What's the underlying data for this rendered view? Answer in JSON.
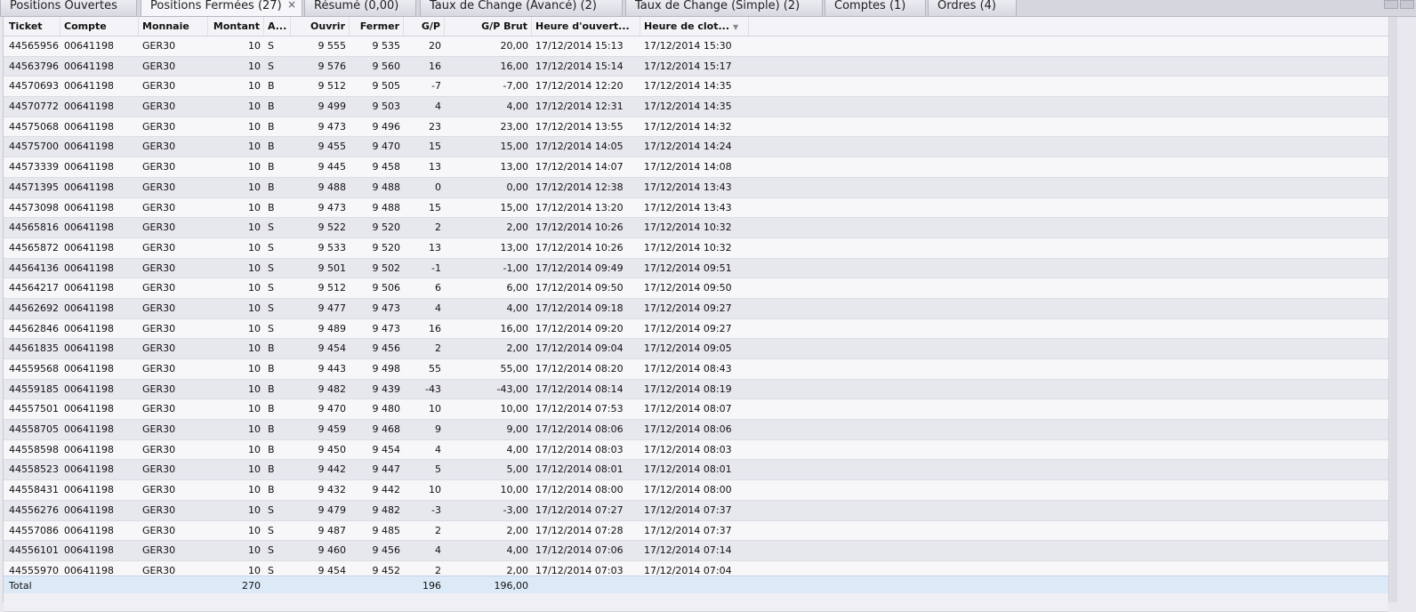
{
  "tabs": [
    {
      "label": "Positions Ouvertes",
      "active": false
    },
    {
      "label": "Positions Fermées (27)",
      "active": true,
      "closable": true
    },
    {
      "label": "Résumé (0,00)",
      "active": false
    },
    {
      "label": "Taux de Change (Avancé) (2)",
      "active": false
    },
    {
      "label": "Taux de Change (Simple) (2)",
      "active": false
    },
    {
      "label": "Comptes (1)",
      "active": false
    },
    {
      "label": "Ordres (4)",
      "active": false
    }
  ],
  "close_glyph": "×",
  "columns": [
    "Ticket",
    "Compte",
    "Monnaie",
    "Montant",
    "A...",
    "Ouvrir",
    "Fermer",
    "G/P",
    "G/P Brut",
    "Heure d'ouvert...",
    "Heure de clot..."
  ],
  "sorted_column_icon": "sort-descending-icon",
  "rows": [
    [
      "44565956",
      "00641198",
      "GER30",
      "10",
      "S",
      "9 555",
      "9 535",
      "20",
      "20,00",
      "17/12/2014 15:13",
      "17/12/2014 15:30"
    ],
    [
      "44563796",
      "00641198",
      "GER30",
      "10",
      "S",
      "9 576",
      "9 560",
      "16",
      "16,00",
      "17/12/2014 15:14",
      "17/12/2014 15:17"
    ],
    [
      "44570693",
      "00641198",
      "GER30",
      "10",
      "B",
      "9 512",
      "9 505",
      "-7",
      "-7,00",
      "17/12/2014 12:20",
      "17/12/2014 14:35"
    ],
    [
      "44570772",
      "00641198",
      "GER30",
      "10",
      "B",
      "9 499",
      "9 503",
      "4",
      "4,00",
      "17/12/2014 12:31",
      "17/12/2014 14:35"
    ],
    [
      "44575068",
      "00641198",
      "GER30",
      "10",
      "B",
      "9 473",
      "9 496",
      "23",
      "23,00",
      "17/12/2014 13:55",
      "17/12/2014 14:32"
    ],
    [
      "44575700",
      "00641198",
      "GER30",
      "10",
      "B",
      "9 455",
      "9 470",
      "15",
      "15,00",
      "17/12/2014 14:05",
      "17/12/2014 14:24"
    ],
    [
      "44573339",
      "00641198",
      "GER30",
      "10",
      "B",
      "9 445",
      "9 458",
      "13",
      "13,00",
      "17/12/2014 14:07",
      "17/12/2014 14:08"
    ],
    [
      "44571395",
      "00641198",
      "GER30",
      "10",
      "B",
      "9 488",
      "9 488",
      "0",
      "0,00",
      "17/12/2014 12:38",
      "17/12/2014 13:43"
    ],
    [
      "44573098",
      "00641198",
      "GER30",
      "10",
      "B",
      "9 473",
      "9 488",
      "15",
      "15,00",
      "17/12/2014 13:20",
      "17/12/2014 13:43"
    ],
    [
      "44565816",
      "00641198",
      "GER30",
      "10",
      "S",
      "9 522",
      "9 520",
      "2",
      "2,00",
      "17/12/2014 10:26",
      "17/12/2014 10:32"
    ],
    [
      "44565872",
      "00641198",
      "GER30",
      "10",
      "S",
      "9 533",
      "9 520",
      "13",
      "13,00",
      "17/12/2014 10:26",
      "17/12/2014 10:32"
    ],
    [
      "44564136",
      "00641198",
      "GER30",
      "10",
      "S",
      "9 501",
      "9 502",
      "-1",
      "-1,00",
      "17/12/2014 09:49",
      "17/12/2014 09:51"
    ],
    [
      "44564217",
      "00641198",
      "GER30",
      "10",
      "S",
      "9 512",
      "9 506",
      "6",
      "6,00",
      "17/12/2014 09:50",
      "17/12/2014 09:50"
    ],
    [
      "44562692",
      "00641198",
      "GER30",
      "10",
      "S",
      "9 477",
      "9 473",
      "4",
      "4,00",
      "17/12/2014 09:18",
      "17/12/2014 09:27"
    ],
    [
      "44562846",
      "00641198",
      "GER30",
      "10",
      "S",
      "9 489",
      "9 473",
      "16",
      "16,00",
      "17/12/2014 09:20",
      "17/12/2014 09:27"
    ],
    [
      "44561835",
      "00641198",
      "GER30",
      "10",
      "B",
      "9 454",
      "9 456",
      "2",
      "2,00",
      "17/12/2014 09:04",
      "17/12/2014 09:05"
    ],
    [
      "44559568",
      "00641198",
      "GER30",
      "10",
      "B",
      "9 443",
      "9 498",
      "55",
      "55,00",
      "17/12/2014 08:20",
      "17/12/2014 08:43"
    ],
    [
      "44559185",
      "00641198",
      "GER30",
      "10",
      "B",
      "9 482",
      "9 439",
      "-43",
      "-43,00",
      "17/12/2014 08:14",
      "17/12/2014 08:19"
    ],
    [
      "44557501",
      "00641198",
      "GER30",
      "10",
      "B",
      "9 470",
      "9 480",
      "10",
      "10,00",
      "17/12/2014 07:53",
      "17/12/2014 08:07"
    ],
    [
      "44558705",
      "00641198",
      "GER30",
      "10",
      "B",
      "9 459",
      "9 468",
      "9",
      "9,00",
      "17/12/2014 08:06",
      "17/12/2014 08:06"
    ],
    [
      "44558598",
      "00641198",
      "GER30",
      "10",
      "B",
      "9 450",
      "9 454",
      "4",
      "4,00",
      "17/12/2014 08:03",
      "17/12/2014 08:03"
    ],
    [
      "44558523",
      "00641198",
      "GER30",
      "10",
      "B",
      "9 442",
      "9 447",
      "5",
      "5,00",
      "17/12/2014 08:01",
      "17/12/2014 08:01"
    ],
    [
      "44558431",
      "00641198",
      "GER30",
      "10",
      "B",
      "9 432",
      "9 442",
      "10",
      "10,00",
      "17/12/2014 08:00",
      "17/12/2014 08:00"
    ],
    [
      "44556276",
      "00641198",
      "GER30",
      "10",
      "S",
      "9 479",
      "9 482",
      "-3",
      "-3,00",
      "17/12/2014 07:27",
      "17/12/2014 07:37"
    ],
    [
      "44557086",
      "00641198",
      "GER30",
      "10",
      "S",
      "9 487",
      "9 485",
      "2",
      "2,00",
      "17/12/2014 07:28",
      "17/12/2014 07:37"
    ],
    [
      "44556101",
      "00641198",
      "GER30",
      "10",
      "S",
      "9 460",
      "9 456",
      "4",
      "4,00",
      "17/12/2014 07:06",
      "17/12/2014 07:14"
    ],
    [
      "44555970",
      "00641198",
      "GER30",
      "10",
      "S",
      "9 454",
      "9 452",
      "2",
      "2,00",
      "17/12/2014 07:03",
      "17/12/2014 07:04"
    ]
  ],
  "total": {
    "label": "Total",
    "montant": "270",
    "gp": "196",
    "gp_brut": "196,00"
  },
  "colors": {
    "total_row": "#dce9f7",
    "alt_row": "#e7e7ee",
    "row": "#f7f7fa"
  }
}
